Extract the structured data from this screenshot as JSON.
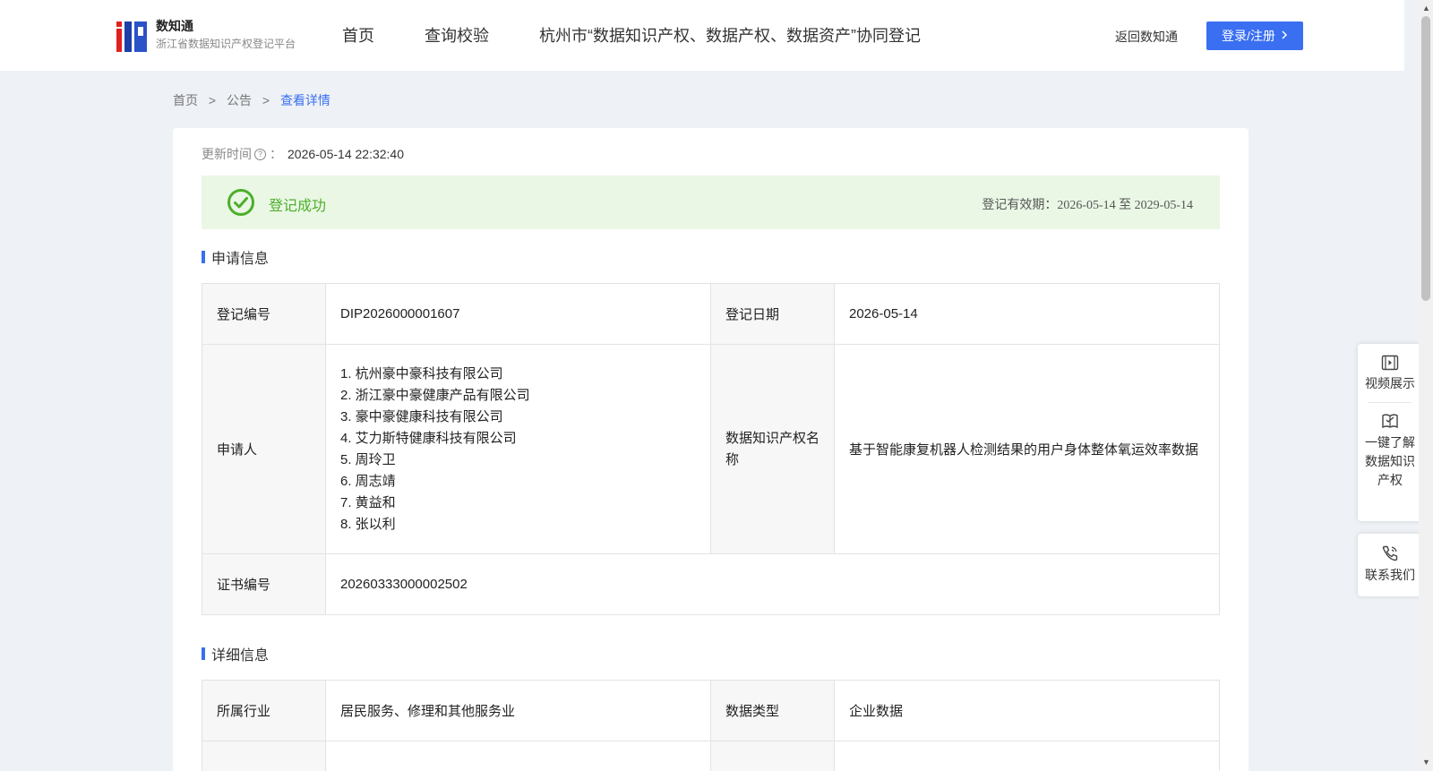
{
  "header": {
    "logo_title": "数知通",
    "logo_subtitle": "浙江省数据知识产权登记平台",
    "nav": [
      "首页",
      "查询校验",
      "杭州市“数据知识产权、数据产权、数据资产”协同登记"
    ],
    "back_link": "返回数知通",
    "login_label": "登录/注册"
  },
  "breadcrumb": {
    "items": [
      "首页",
      "公告",
      "查看详情"
    ],
    "separator": ">"
  },
  "update": {
    "label": "更新时间",
    "colon": "：",
    "value": "2026-05-14 22:32:40"
  },
  "status": {
    "text": "登记成功",
    "validity": "登记有效期：2026-05-14 至 2029-05-14",
    "color": "#4caf2a"
  },
  "sections": {
    "apply_title": "申请信息",
    "detail_title": "详细信息"
  },
  "apply": {
    "reg_no_label": "登记编号",
    "reg_no": "DIP2026000001607",
    "reg_date_label": "登记日期",
    "reg_date": "2026-05-14",
    "applicant_label": "申请人",
    "applicants": [
      "1. 杭州豪中豪科技有限公司",
      "2. 浙江豪中豪健康产品有限公司",
      "3. 豪中豪健康科技有限公司",
      "4. 艾力斯特健康科技有限公司",
      "5. 周玲卫",
      "6. 周志靖",
      "7. 黄益和",
      "8. 张以利"
    ],
    "ip_name_label": "数据知识产权名称",
    "ip_name": "基于智能康复机器人检测结果的用户身体整体氧运效率数据",
    "cert_no_label": "证书编号",
    "cert_no": "20260333000002502"
  },
  "detail": {
    "industry_label": "所属行业",
    "industry": "居民服务、修理和其他服务业",
    "data_type_label": "数据类型",
    "data_type": "企业数据"
  },
  "float_widgets": {
    "video": "视频展示",
    "learn": "一键了解数据知识产权",
    "contact": "联系我们"
  },
  "colors": {
    "accent": "#3a6ff2",
    "success_bg": "#eaf7e5"
  }
}
